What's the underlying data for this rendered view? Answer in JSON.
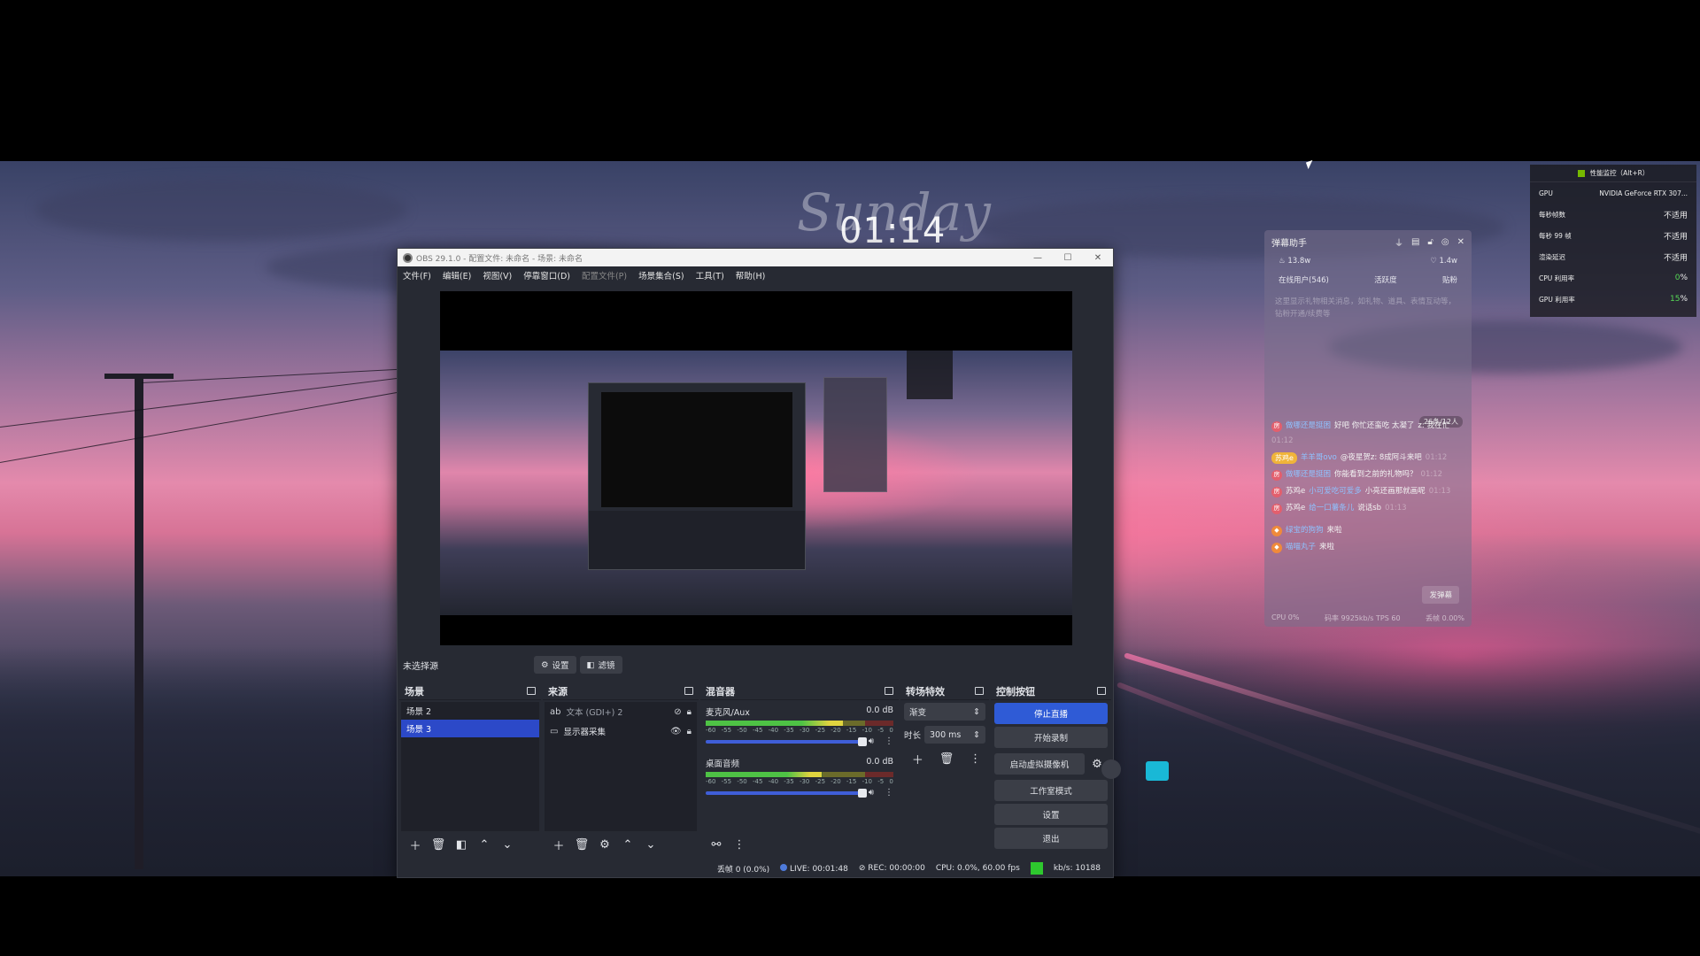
{
  "desktop": {
    "clock": "01:14",
    "wallpaper_signature": "Sunday"
  },
  "obs": {
    "title": "OBS 29.1.0 - 配置文件: 未命名 - 场景: 未命名",
    "menu": [
      "文件(F)",
      "编辑(E)",
      "视图(V)",
      "停靠窗口(D)",
      "配置文件(P)",
      "场景集合(S)",
      "工具(T)",
      "帮助(H)"
    ],
    "scene_bar": {
      "label": "未选择源",
      "settings": "设置",
      "filters": "滤镜"
    },
    "scenes": {
      "title": "场景",
      "items": [
        "场景 2",
        "场景 3"
      ],
      "selected_index": 1
    },
    "sources": {
      "title": "来源",
      "items": [
        {
          "label": "文本 (GDI+) 2",
          "visible": false
        },
        {
          "label": "显示器采集",
          "visible": true
        }
      ]
    },
    "mixer": {
      "title": "混音器",
      "channels": [
        {
          "name": "麦克风/Aux",
          "db": "0.0 dB",
          "level": 0.73
        },
        {
          "name": "桌面音频",
          "db": "0.0 dB",
          "level": 0.62
        }
      ],
      "scale": [
        "-60",
        "-55",
        "-50",
        "-45",
        "-40",
        "-35",
        "-30",
        "-25",
        "-20",
        "-15",
        "-10",
        "-5",
        "0"
      ]
    },
    "transitions": {
      "title": "转场特效",
      "type": "渐变",
      "duration_label": "时长",
      "duration": "300 ms"
    },
    "controls": {
      "title": "控制按钮",
      "buttons": [
        "停止直播",
        "开始录制",
        "启动虚拟摄像机",
        "工作室模式",
        "设置",
        "退出"
      ]
    },
    "status": {
      "dropped": "丢帧 0 (0.0%)",
      "live": "LIVE: 00:01:48",
      "rec": "REC: 00:00:00",
      "cpu": "CPU: 0.0%, 60.00 fps",
      "kbps": "kb/s: 10188"
    }
  },
  "danmaku": {
    "title": "弹幕助手",
    "heat": "13.8w",
    "likes": "1.4w",
    "tabs": [
      "在线用户(546)",
      "活跃度",
      "贴粉"
    ],
    "hint": "这里显示礼物相关消息，如礼物、道具、表情互动等，钻粉开通/续费等",
    "count_badge": "26条/12人",
    "messages": [
      {
        "user": "做哪还是挺困",
        "text": "好吧 你忙还蛮吃 太凝了",
        "extra": "z: 我在忙",
        "time": "01:12"
      },
      {
        "user": "苏鸡e",
        "user2": "羊羊哥ovo",
        "text": "@夜星贺z: 8成阿斗来吧",
        "time": "01:12"
      },
      {
        "user": "做哪还是挺困",
        "text": "你能看到之前的礼物吗？",
        "time": "01:12"
      },
      {
        "user": "苏鸡e",
        "user2": "小可爱吃可爱多",
        "text": "小亮还画那就画呢",
        "time": "01:13"
      },
      {
        "user": "苏鸡e",
        "user2": "给一口薯条儿",
        "text": "说话sb",
        "time": "01:13"
      },
      {
        "user": "绿宝的狗狗",
        "text": "来啦"
      },
      {
        "user": "喵喵丸子",
        "text": "来啦"
      }
    ],
    "send_label": "发弹幕",
    "footer": {
      "cpu": "CPU 0%",
      "net": "码率 9925kb/s TPS 60",
      "loss": "丢帧 0.00%"
    }
  },
  "perf_overlay": {
    "header": "性能监控（Alt+R）",
    "rows": [
      {
        "label": "GPU",
        "value": "NVIDIA GeForce RTX 307..."
      },
      {
        "label": "每秒帧数",
        "value": "不适用"
      },
      {
        "label": "每秒 99 帧",
        "value": "不适用"
      },
      {
        "label": "渲染延迟",
        "value": "不适用"
      },
      {
        "label": "CPU 利用率",
        "value": "0",
        "unit": "%"
      },
      {
        "label": "GPU 利用率",
        "value": "15",
        "unit": "%"
      }
    ]
  }
}
